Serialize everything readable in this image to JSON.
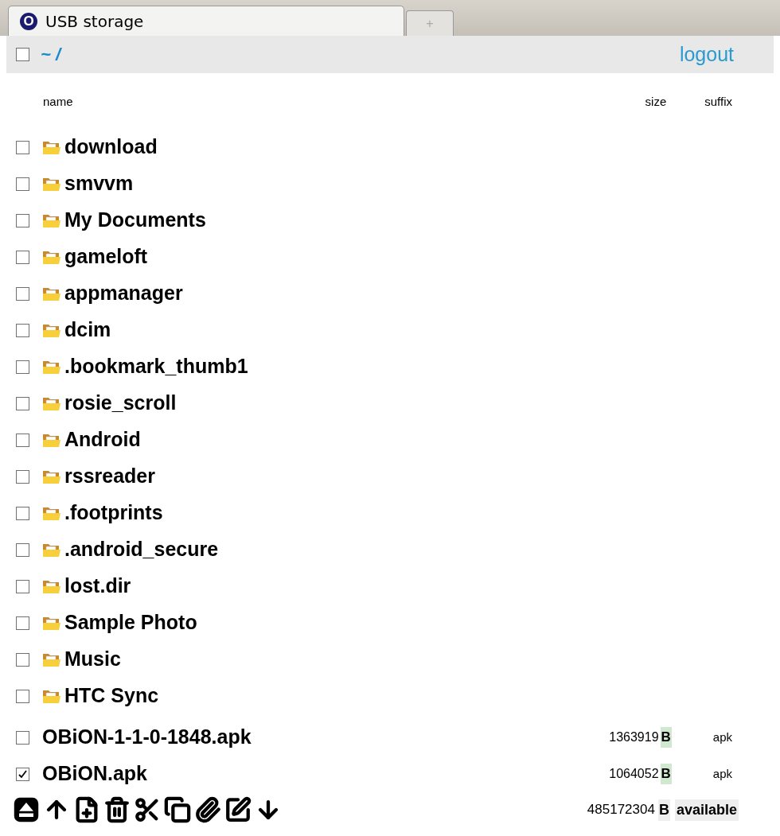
{
  "tab": {
    "title": "USB storage",
    "icon_letter": "O",
    "new_tab": "+"
  },
  "path_bar": {
    "checked": false,
    "path": "~ /",
    "logout": "logout"
  },
  "columns": {
    "name": "name",
    "size": "size",
    "suffix": "suffix"
  },
  "folders": [
    {
      "name": "download",
      "checked": false
    },
    {
      "name": "smvvm",
      "checked": false
    },
    {
      "name": "My Documents",
      "checked": false
    },
    {
      "name": "gameloft",
      "checked": false
    },
    {
      "name": "appmanager",
      "checked": false
    },
    {
      "name": "dcim",
      "checked": false
    },
    {
      "name": ".bookmark_thumb1",
      "checked": false
    },
    {
      "name": "rosie_scroll",
      "checked": false
    },
    {
      "name": "Android",
      "checked": false
    },
    {
      "name": "rssreader",
      "checked": false
    },
    {
      "name": ".footprints",
      "checked": false
    },
    {
      "name": ".android_secure",
      "checked": false
    },
    {
      "name": "lost.dir",
      "checked": false
    },
    {
      "name": "Sample Photo",
      "checked": false
    },
    {
      "name": "Music",
      "checked": false
    },
    {
      "name": "HTC Sync",
      "checked": false
    }
  ],
  "files": [
    {
      "name": "OBiON-1-1-0-1848.apk",
      "checked": false,
      "size": "1363919",
      "unit": "B",
      "suffix": "apk"
    },
    {
      "name": "OBiON.apk",
      "checked": true,
      "size": "1064052",
      "unit": "B",
      "suffix": "apk"
    }
  ],
  "footer": {
    "free": "485172304",
    "unit": "B",
    "label": "available"
  }
}
